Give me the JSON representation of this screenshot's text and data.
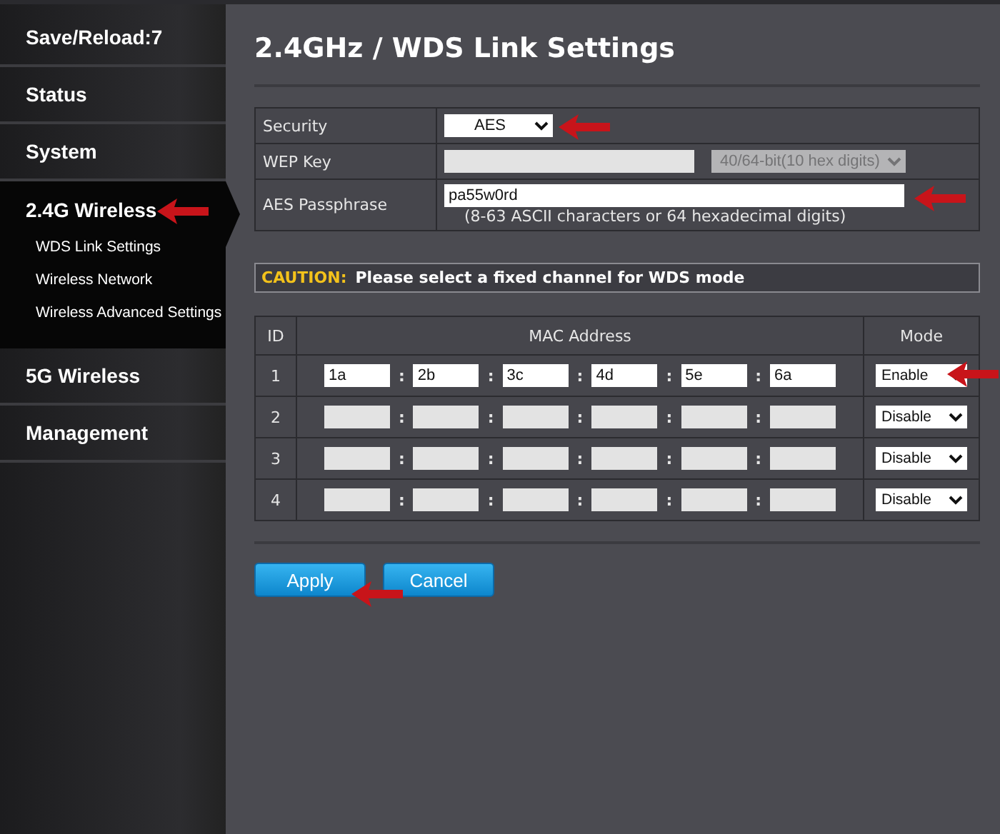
{
  "sidebar": {
    "items": [
      {
        "label": "Save/Reload:7",
        "expanded": false
      },
      {
        "label": "Status",
        "expanded": false
      },
      {
        "label": "System",
        "expanded": false
      },
      {
        "label": "2.4G Wireless",
        "expanded": true,
        "children": [
          {
            "label": "WDS Link Settings"
          },
          {
            "label": "Wireless Network"
          },
          {
            "label": "Wireless Advanced Settings"
          }
        ]
      },
      {
        "label": "5G Wireless",
        "expanded": false
      },
      {
        "label": "Management",
        "expanded": false
      }
    ]
  },
  "page_title": "2.4GHz / WDS Link Settings",
  "security_form": {
    "rows": [
      {
        "kind": "select",
        "label": "Security",
        "value": "AES"
      },
      {
        "kind": "wep",
        "label": "WEP Key",
        "disabled": true,
        "key_length": "40/64-bit(10 hex digits)"
      },
      {
        "kind": "passphrase",
        "label": "AES Passphrase",
        "value": "pa55w0rd",
        "hint": "(8-63 ASCII characters or 64 hexadecimal digits)"
      }
    ]
  },
  "caution": {
    "label": "CAUTION:",
    "message": "Please select a fixed channel for WDS mode"
  },
  "wds_table": {
    "columns": [
      "ID",
      "MAC Address",
      "Mode"
    ],
    "rows": [
      {
        "id": "1",
        "octets": [
          {
            "value": "1a",
            "disabled": false
          },
          {
            "value": "2b",
            "disabled": false
          },
          {
            "value": "3c",
            "disabled": false
          },
          {
            "value": "4d",
            "disabled": false
          },
          {
            "value": "5e",
            "disabled": false
          },
          {
            "value": "6a",
            "disabled": false
          }
        ],
        "separators": [
          ":",
          ":",
          ":",
          ":",
          ":"
        ],
        "mode": "Enable"
      },
      {
        "id": "2",
        "octets": [
          {
            "disabled": true
          },
          {
            "disabled": true
          },
          {
            "disabled": true
          },
          {
            "disabled": true
          },
          {
            "disabled": true
          },
          {
            "disabled": true
          }
        ],
        "separators": [
          ":",
          ":",
          ":",
          ":",
          ":"
        ],
        "mode": "Disable"
      },
      {
        "id": "3",
        "octets": [
          {
            "disabled": true
          },
          {
            "disabled": true
          },
          {
            "disabled": true
          },
          {
            "disabled": true
          },
          {
            "disabled": true
          },
          {
            "disabled": true
          }
        ],
        "separators": [
          ":",
          ":",
          ":",
          ":",
          ":"
        ],
        "mode": "Disable"
      },
      {
        "id": "4",
        "octets": [
          {
            "disabled": true
          },
          {
            "disabled": true
          },
          {
            "disabled": true
          },
          {
            "disabled": true
          },
          {
            "disabled": true
          },
          {
            "disabled": true
          }
        ],
        "separators": [
          ":",
          ":",
          ":",
          ":",
          ":"
        ],
        "mode": "Disable"
      }
    ]
  },
  "buttons": [
    "Apply",
    "Cancel"
  ]
}
